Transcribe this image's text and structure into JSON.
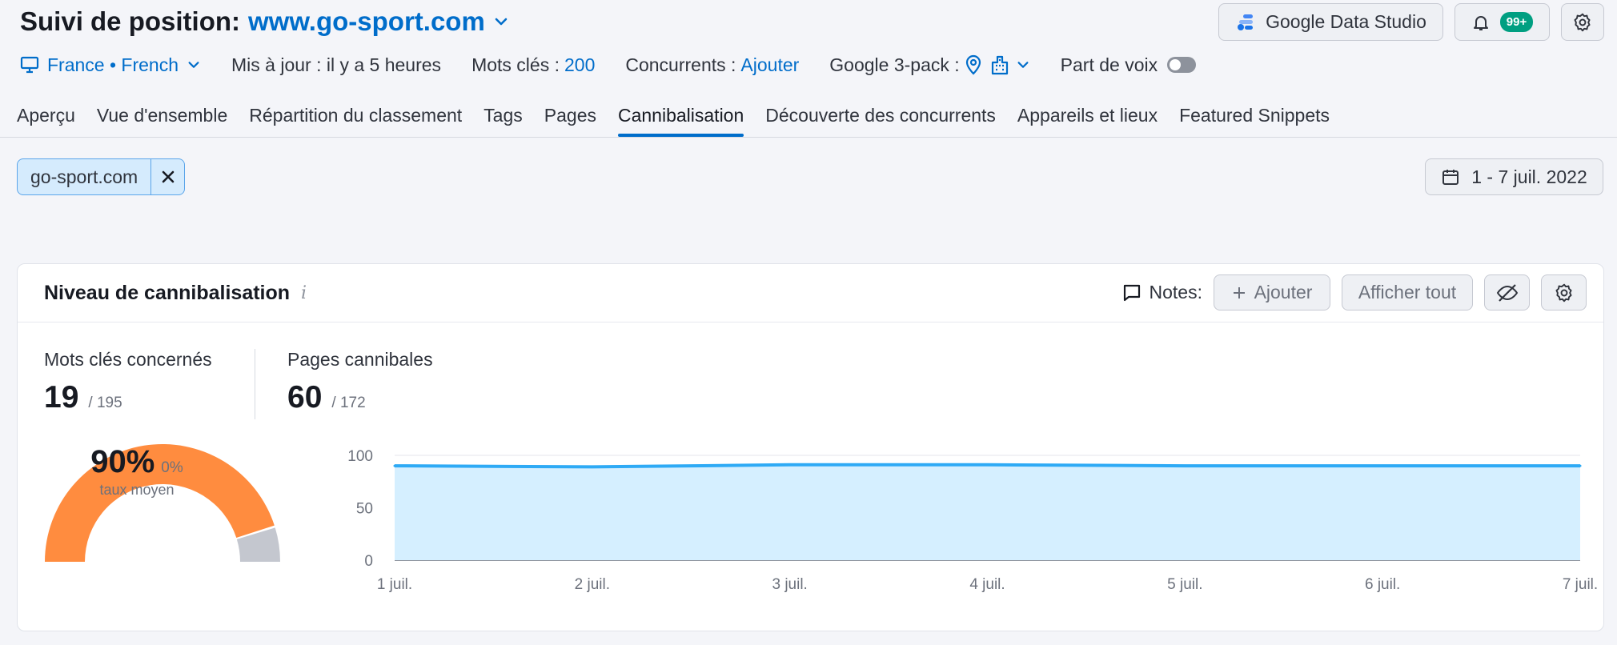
{
  "header": {
    "title_prefix": "Suivi de position:",
    "domain": "www.go-sport.com",
    "gds_label": "Google Data Studio",
    "notif_badge": "99+"
  },
  "subbar": {
    "location": "France • French",
    "updated": "Mis à jour : il y a 5 heures",
    "keywords_label": "Mots clés :",
    "keywords_count": "200",
    "competitors_label": "Concurrents :",
    "competitors_action": "Ajouter",
    "pack_label": "Google 3-pack :",
    "share_label": "Part de voix"
  },
  "tabs": [
    {
      "label": "Aperçu"
    },
    {
      "label": "Vue d'ensemble"
    },
    {
      "label": "Répartition du classement"
    },
    {
      "label": "Tags"
    },
    {
      "label": "Pages"
    },
    {
      "label": "Cannibalisation"
    },
    {
      "label": "Découverte des concurrents"
    },
    {
      "label": "Appareils et lieux"
    },
    {
      "label": "Featured Snippets"
    }
  ],
  "active_tab": "Cannibalisation",
  "filter_chip": "go-sport.com",
  "date_range": "1 - 7 juil. 2022",
  "card": {
    "title": "Niveau de cannibalisation",
    "info": "i",
    "notes_label": "Notes:",
    "add_label": "Ajouter",
    "show_all_label": "Afficher tout"
  },
  "metrics": {
    "keywords_label": "Mots clés concernés",
    "keywords_value": "19",
    "keywords_total": "/ 195",
    "pages_label": "Pages cannibales",
    "pages_value": "60",
    "pages_total": "/ 172"
  },
  "gauge": {
    "percent_label": "90%",
    "change_label": "0%",
    "caption": "taux moyen",
    "value": 90
  },
  "colors": {
    "accent": "#006dca",
    "gauge_fill": "#ff8c3f",
    "gauge_rest": "#c4c7cf",
    "area_fill": "#d5efff",
    "line": "#2eaaf5"
  },
  "chart_data": {
    "type": "area",
    "x": [
      "1 juil.",
      "2 juil.",
      "3 juil.",
      "4 juil.",
      "5 juil.",
      "6 juil.",
      "7 juil."
    ],
    "series": [
      {
        "values": [
          90,
          89,
          91,
          91,
          90,
          90,
          90
        ]
      }
    ],
    "yticks": [
      "0",
      "50",
      "100"
    ],
    "ylim": [
      0,
      100
    ],
    "grid": true
  }
}
